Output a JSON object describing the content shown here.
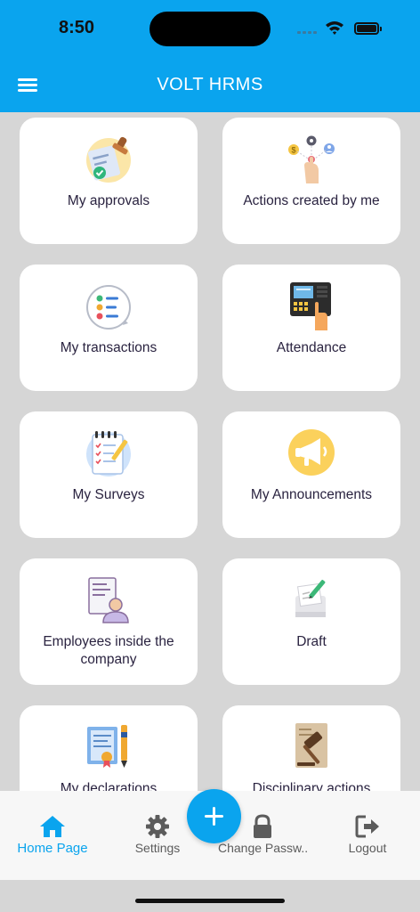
{
  "status_bar": {
    "time": "8:50"
  },
  "header": {
    "title": "VOLT HRMS",
    "menu_icon": "hamburger-menu-icon",
    "color": "#0aa4ee"
  },
  "cards": [
    {
      "label": "My approvals",
      "icon": "approval-stamp-icon"
    },
    {
      "label": "Actions created by me",
      "icon": "hand-actions-icon"
    },
    {
      "label": "My transactions",
      "icon": "transactions-checklist-icon"
    },
    {
      "label": "Attendance",
      "icon": "fingerprint-terminal-icon"
    },
    {
      "label": "My Surveys",
      "icon": "survey-clipboard-icon"
    },
    {
      "label": "My Announcements",
      "icon": "megaphone-icon"
    },
    {
      "label": "Employees inside the company",
      "icon": "employee-profile-icon"
    },
    {
      "label": "Draft",
      "icon": "draft-pencil-icon"
    },
    {
      "label": "My declarations",
      "icon": "declaration-certificate-icon"
    },
    {
      "label": "Disciplinary actions",
      "icon": "gavel-icon"
    }
  ],
  "bottom_nav": {
    "items": [
      {
        "label": "Home Page",
        "icon": "home-icon",
        "active": true
      },
      {
        "label": "Settings",
        "icon": "gear-icon",
        "active": false
      },
      {
        "label": "Change Passw...",
        "icon": "lock-icon",
        "active": false
      },
      {
        "label": "Logout",
        "icon": "logout-icon",
        "active": false
      }
    ],
    "fab_icon": "plus-icon"
  }
}
